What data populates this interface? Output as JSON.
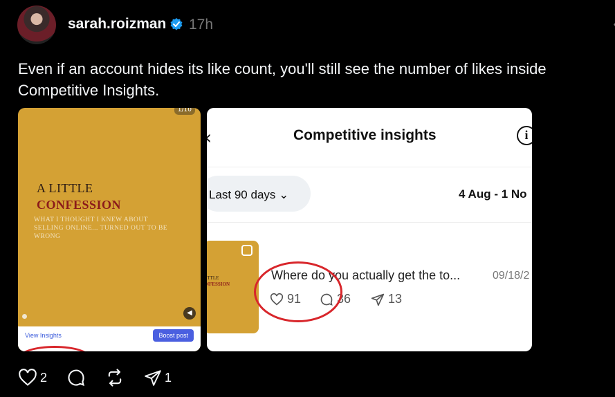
{
  "post": {
    "username": "sarah.roizman",
    "time": "17h",
    "caption": "Even if an account hides its like count, you'll still see the number of likes inside Competitive Insights."
  },
  "image1": {
    "page_indicator": "1/10",
    "title_line1": "A LITTLE",
    "title_line2": "CONFESSION",
    "subtitle": "WHAT I THOUGHT I KNEW ABOUT SELLING ONLINE... TURNED OUT TO BE WRONG",
    "view_insights": "View Insights",
    "boost_post": "Boost post",
    "colors": {
      "background": "#d4a134",
      "highlight": "#d8262b"
    }
  },
  "image2": {
    "title": "Competitive insights",
    "range_label": "Last 90 days ⌄",
    "date_range": "4 Aug - 1 No",
    "thumb_line1": "ITTLE",
    "thumb_line2": "NFESSION",
    "post_title": "Where do you actually get the to...",
    "post_date": "09/18/2",
    "likes": "91",
    "comments": "36",
    "shares": "13"
  },
  "actions": {
    "likes": "2",
    "shares": "1"
  }
}
